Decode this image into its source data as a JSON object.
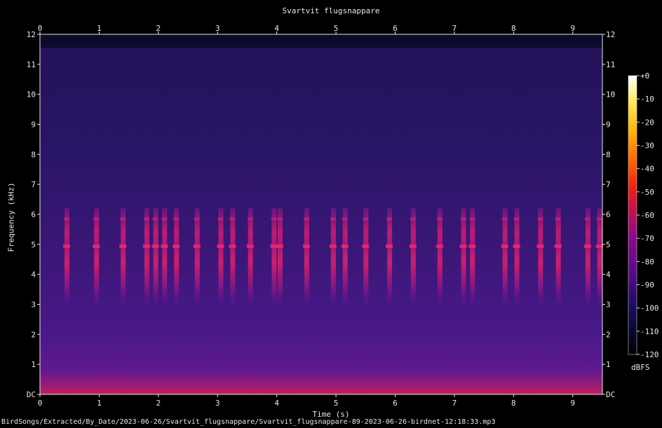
{
  "chart_data": {
    "type": "heatmap",
    "title": "Svartvit flugsnappare",
    "xlabel": "Time (s)",
    "ylabel": "Frequency (kHz)",
    "xlim": [
      0,
      9.5
    ],
    "ylim": [
      0,
      12
    ],
    "x_ticks": [
      "0",
      "1",
      "2",
      "3",
      "4",
      "5",
      "6",
      "7",
      "8",
      "9"
    ],
    "y_ticks": [
      "DC",
      "1",
      "2",
      "3",
      "4",
      "5",
      "6",
      "7",
      "8",
      "9",
      "10",
      "11",
      "12"
    ],
    "colorbar": {
      "unit": "dBFS",
      "range": [
        -120,
        0
      ],
      "ticks": [
        "+0",
        "-10",
        "-20",
        "-30",
        "-40",
        "-50",
        "-60",
        "-70",
        "-80",
        "-90",
        "-100",
        "-110",
        "-120"
      ],
      "colors": [
        "#000000",
        "#0a0a3c",
        "#2a0a6e",
        "#5a0a8c",
        "#8c0a8c",
        "#c8104a",
        "#f02010",
        "#ff6a00",
        "#ffb400",
        "#ffe650",
        "#ffffff"
      ]
    },
    "call_times_s": [
      0.45,
      0.95,
      1.4,
      1.8,
      1.95,
      2.1,
      2.3,
      2.65,
      3.05,
      3.25,
      3.55,
      3.95,
      4.05,
      4.5,
      4.95,
      5.15,
      5.5,
      5.9,
      6.3,
      6.75,
      7.15,
      7.3,
      7.85,
      8.05,
      8.45,
      8.75,
      9.25,
      9.45
    ],
    "call_freq_khz": {
      "main": 4.95,
      "upper": 5.85,
      "low_end": 3.0,
      "high_end": 6.2
    }
  },
  "footer": {
    "file_path": "BirdSongs/Extracted/By_Date/2023-06-26/Svartvit_flugsnappare/Svartvit_flugsnappare-89-2023-06-26-birdnet-12:18:33.mp3"
  }
}
